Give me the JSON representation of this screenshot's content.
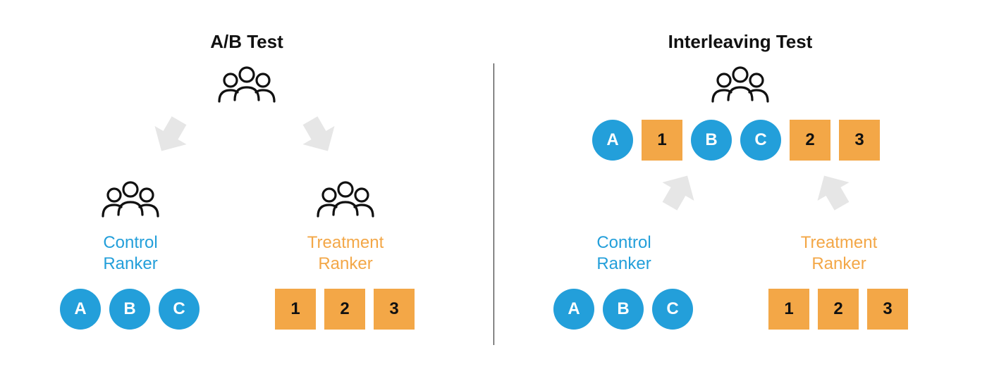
{
  "left": {
    "title": "A/B Test",
    "control": {
      "label_line1": "Control",
      "label_line2": "Ranker",
      "items": [
        "A",
        "B",
        "C"
      ]
    },
    "treatment": {
      "label_line1": "Treatment",
      "label_line2": "Ranker",
      "items": [
        "1",
        "2",
        "3"
      ]
    }
  },
  "right": {
    "title": "Interleaving Test",
    "mixed": [
      {
        "shape": "circle",
        "label": "A"
      },
      {
        "shape": "square",
        "label": "1"
      },
      {
        "shape": "circle",
        "label": "B"
      },
      {
        "shape": "circle",
        "label": "C"
      },
      {
        "shape": "square",
        "label": "2"
      },
      {
        "shape": "square",
        "label": "3"
      }
    ],
    "control": {
      "label_line1": "Control",
      "label_line2": "Ranker",
      "items": [
        "A",
        "B",
        "C"
      ]
    },
    "treatment": {
      "label_line1": "Treatment",
      "label_line2": "Ranker",
      "items": [
        "1",
        "2",
        "3"
      ]
    }
  },
  "colors": {
    "blue": "#239fda",
    "orange": "#f3a747",
    "arrow": "#e4e4e4"
  }
}
